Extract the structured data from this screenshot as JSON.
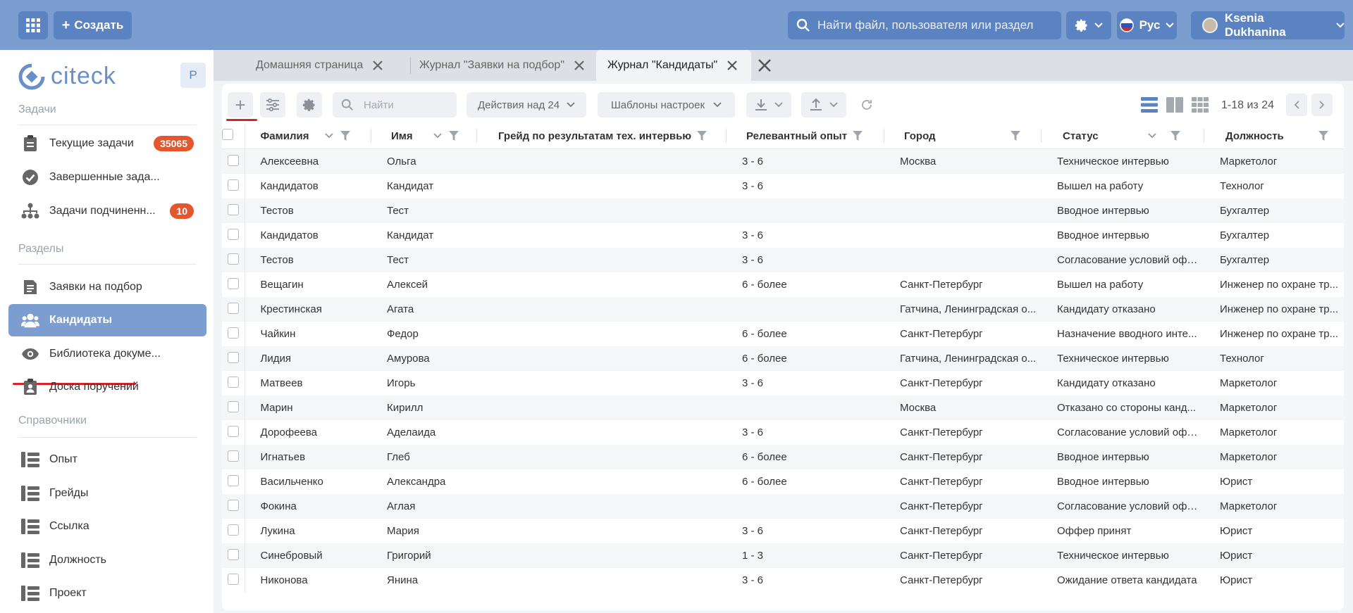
{
  "header": {
    "create_label": "Создать",
    "search_placeholder": "Найти файл, пользователя или раздел",
    "lang_label": "Рус",
    "user_name": "Ksenia Dukhanina",
    "icons": [
      "apps-grid-icon",
      "plus-icon",
      "search-icon",
      "gear-icon",
      "russian-flag-icon",
      "chevron-down-icon"
    ]
  },
  "sidebar": {
    "logo_text": "citeck",
    "profile_badge": "P",
    "sections": {
      "tasks": "Задачи",
      "sections": "Разделы",
      "directories": "Справочники"
    },
    "items": [
      {
        "label": "Текущие задачи",
        "badge": "35065",
        "icon": "clipboard-icon"
      },
      {
        "label": "Завершенные зада...",
        "icon": "check-circle-icon"
      },
      {
        "label": "Задачи подчиненн...",
        "badge": "10",
        "icon": "hierarchy-icon"
      },
      {
        "label": "Заявки на подбор",
        "icon": "document-list-icon"
      },
      {
        "label": "Кандидаты",
        "icon": "people-icon",
        "active": true
      },
      {
        "label": "Библиотека докуме...",
        "icon": "eye-icon"
      },
      {
        "label": "Доска поручений",
        "icon": "clipboard-user-icon"
      },
      {
        "label": "Опыт",
        "icon": "tree-list-icon"
      },
      {
        "label": "Грейды",
        "icon": "tree-list-icon"
      },
      {
        "label": "Ссылка",
        "icon": "tree-list-icon"
      },
      {
        "label": "Должность",
        "icon": "tree-list-icon"
      },
      {
        "label": "Проект",
        "icon": "tree-list-icon"
      }
    ]
  },
  "tabs": [
    {
      "label": "Домашняя страница"
    },
    {
      "label": "Журнал \"Заявки на подбор\""
    },
    {
      "label": "Журнал \"Кандидаты\"",
      "active": true
    }
  ],
  "toolbar": {
    "search_placeholder": "Найти",
    "actions_label": "Действия над 24",
    "templates_label": "Шаблоны настроек",
    "pager": "1-18 из 24"
  },
  "table": {
    "columns": [
      "Фамилия",
      "Имя",
      "Грейд по результатам тех. интервью",
      "Релевантный опыт",
      "Город",
      "Статус",
      "Должность"
    ],
    "rows": [
      [
        "Алексеевна",
        "Ольга",
        "",
        "3 - 6",
        "Москва",
        "Техническое интервью",
        "Маркетолог"
      ],
      [
        "Кандидатов",
        "Кандидат",
        "",
        "3 - 6",
        "",
        "Вышел на работу",
        "Технолог"
      ],
      [
        "Тестов",
        "Тест",
        "",
        "",
        "",
        "Вводное интервью",
        "Бухгалтер"
      ],
      [
        "Кандидатов",
        "Кандидат",
        "",
        "3 - 6",
        "",
        "Вводное интервью",
        "Бухгалтер"
      ],
      [
        "Тестов",
        "Тест",
        "",
        "3 - 6",
        "",
        "Согласование условий офф...",
        "Бухгалтер"
      ],
      [
        "Вещагин",
        "Алексей",
        "",
        "6 - более",
        "Санкт-Петербург",
        "Вышел на работу",
        "Инженер по охране тр..."
      ],
      [
        "Крестинская",
        "Агата",
        "",
        "",
        "Гатчина, Ленинградская о...",
        "Кандидату отказано",
        "Инженер по охране тр..."
      ],
      [
        "Чайкин",
        "Федор",
        "",
        "6 - более",
        "Санкт-Петербург",
        "Назначение вводного инте...",
        "Инженер по охране тр..."
      ],
      [
        "Лидия",
        "Амурова",
        "",
        "6 - более",
        "Гатчина, Ленинградская о...",
        "Техническое интервью",
        "Технолог"
      ],
      [
        "Матвеев",
        "Игорь",
        "",
        "3 - 6",
        "Санкт-Петербург",
        "Кандидату отказано",
        "Маркетолог"
      ],
      [
        "Марин",
        "Кирилл",
        "",
        "",
        "Москва",
        "Отказано со стороны канд...",
        "Маркетолог"
      ],
      [
        "Дорофеева",
        "Аделаида",
        "",
        "3 - 6",
        "Санкт-Петербург",
        "Согласование условий офф...",
        "Маркетолог"
      ],
      [
        "Игнатьев",
        "Глеб",
        "",
        "6 - более",
        "Санкт-Петербург",
        "Вводное интервью",
        "Маркетолог"
      ],
      [
        "Васильченко",
        "Александра",
        "",
        "6 - более",
        "Санкт-Петербург",
        "Вводное интервью",
        "Юрист"
      ],
      [
        "Фокина",
        "Аглая",
        "",
        "",
        "Санкт-Петербург",
        "Согласование условий офф...",
        "Маркетолог"
      ],
      [
        "Лукина",
        "Мария",
        "",
        "3 - 6",
        "Санкт-Петербург",
        "Оффер принят",
        "Юрист"
      ],
      [
        "Синебровый",
        "Григорий",
        "",
        "1 - 3",
        "Санкт-Петербург",
        "Техническое интервью",
        "Юрист"
      ],
      [
        "Никонова",
        "Янина",
        "",
        "3 - 6",
        "Санкт-Петербург",
        "Ожидание ответа кандидата",
        "Юрист"
      ]
    ]
  },
  "colors": {
    "header_bg": "#7b9dd0",
    "header_btn": "#5b83c2",
    "badge": "#e4572e",
    "accent_underline": "#d9232a"
  }
}
